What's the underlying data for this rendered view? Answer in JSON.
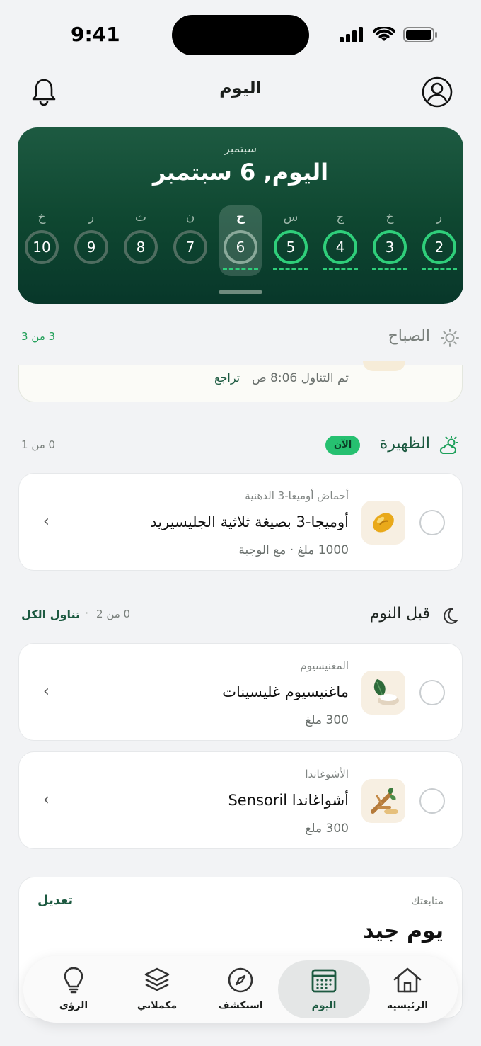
{
  "status": {
    "time": "9:41"
  },
  "header": {
    "title": "اليوم"
  },
  "hero": {
    "month": "سبتمبر",
    "title": "اليوم, 6 سبتمبر",
    "days": [
      {
        "letter": "ر",
        "num": "2",
        "done": true
      },
      {
        "letter": "خ",
        "num": "3",
        "done": true
      },
      {
        "letter": "ج",
        "num": "4",
        "done": true
      },
      {
        "letter": "س",
        "num": "5",
        "done": true
      },
      {
        "letter": "ح",
        "num": "6",
        "done": false,
        "selected": true
      },
      {
        "letter": "ن",
        "num": "7",
        "done": false
      },
      {
        "letter": "ث",
        "num": "8",
        "done": false
      },
      {
        "letter": "ر",
        "num": "9",
        "done": false
      },
      {
        "letter": "خ",
        "num": "10",
        "done": false
      }
    ]
  },
  "morning": {
    "label": "الصباح",
    "count": "3 من 3",
    "taken_text": "تم التناول 8:06 ص",
    "undo": "تراجع"
  },
  "noon": {
    "label": "الظهيرة",
    "badge": "الآن",
    "count": "0 من 1",
    "item": {
      "category": "أحماض أوميغا-3 الدهنية",
      "name": "أوميجا-3 بصيغة ثلاثية الجليسيريد",
      "dose": "1000 ملغ · مع الوجبة"
    }
  },
  "bedtime": {
    "label": "قبل النوم",
    "count": "0 من 2",
    "take_all": "تناول الكل",
    "items": [
      {
        "category": "المغنيسيوم",
        "name": "ماغنيسيوم غليسينات",
        "dose": "300 ملغ"
      },
      {
        "category": "الأشوغاندا",
        "name": "أشواغاندا Sensoril",
        "dose": "300 ملغ"
      }
    ]
  },
  "tracking": {
    "label": "متابعتك",
    "edit": "تعديل",
    "title": "يوم جيد"
  },
  "nav": {
    "home": "الرئيسية",
    "today": "اليوم",
    "explore": "استكشف",
    "supplements": "مكملاتي",
    "insights": "الرؤى"
  },
  "colors": {
    "accent": "#26c070",
    "hero_dark": "#0e4630"
  }
}
